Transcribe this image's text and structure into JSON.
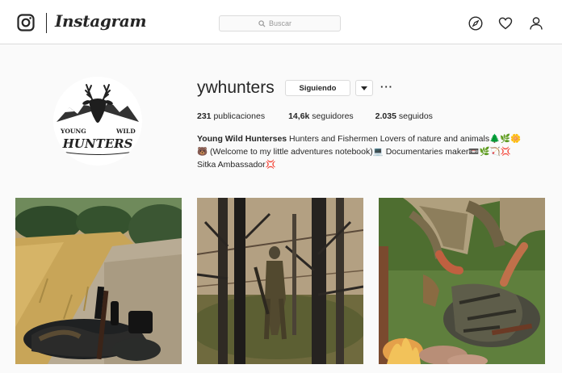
{
  "nav": {
    "wordmark": "Instagram",
    "search_placeholder": "Buscar",
    "icons": [
      "instagram-camera-icon",
      "compass-icon",
      "heart-icon",
      "user-icon"
    ]
  },
  "profile": {
    "username": "ywhunters",
    "follow_label": "Siguiendo",
    "more_label": "···",
    "stats": {
      "posts_count": "231",
      "posts_label": "publicaciones",
      "followers_count": "14,6k",
      "followers_label": "seguidores",
      "following_count": "2.035",
      "following_label": "seguidos"
    },
    "bio": {
      "name": "Young Wild Hunterses",
      "line1": " Hunters and Fishermen Lovers of nature and animals🌲🌿🌼",
      "line2": "🐻 (Welcome to my little adventures notebook)💻 Documentaries maker📼🌿🏹💢",
      "line3": "Sitka Ambassador💢"
    },
    "avatar_logo": {
      "line1": "YOUNG",
      "line2": "WILD",
      "line3": "HUNTERS"
    }
  },
  "posts": [
    {
      "subject": "rifle and gear on a dirt path beside a golden field"
    },
    {
      "subject": "hunter in camouflage among forest trees"
    },
    {
      "subject": "camouflaged hunter kneeling over gear with a campfire"
    }
  ],
  "colors": {
    "text": "#262626",
    "border": "#dbdbdb",
    "background": "#fafafa"
  }
}
